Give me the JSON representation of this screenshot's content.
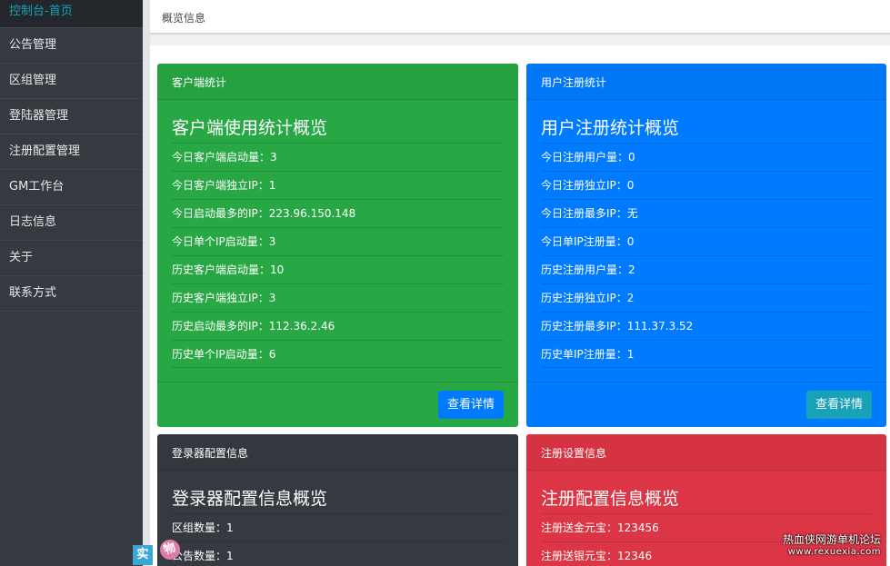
{
  "sidebar": {
    "items": [
      {
        "label": "控制台-首页"
      },
      {
        "label": "公告管理"
      },
      {
        "label": "区组管理"
      },
      {
        "label": "登陆器管理"
      },
      {
        "label": "注册配置管理"
      },
      {
        "label": "GM工作台"
      },
      {
        "label": "日志信息"
      },
      {
        "label": "关于"
      },
      {
        "label": "联系方式"
      }
    ],
    "active_color": "#17a2b8"
  },
  "header": {
    "title": "概览信息"
  },
  "cards": {
    "client": {
      "header": "客户端统计",
      "title": "客户端使用统计概览",
      "rows": [
        "今日客户端启动量：3",
        "今日客户端独立IP：1",
        "今日启动最多的IP：223.96.150.148",
        "今日单个IP启动量：3",
        "历史客户端启动量：10",
        "历史客户端独立IP：3",
        "历史启动最多的IP：112.36.2.46",
        "历史单个IP启动量：6"
      ],
      "button": "查看详情",
      "color": "#28a745"
    },
    "register": {
      "header": "用户注册统计",
      "title": "用户注册统计概览",
      "rows": [
        "今日注册用户量：0",
        "今日注册独立IP：0",
        "今日注册最多IP：无",
        "今日单IP注册量：0",
        "历史注册用户量：2",
        "历史注册独立IP：2",
        "历史注册最多IP：111.37.3.52",
        "历史单IP注册量：1"
      ],
      "button": "查看详情",
      "color": "#007bff"
    },
    "launcher": {
      "header": "登录器配置信息",
      "title": "登录器配置信息概览",
      "rows": [
        "区组数量：1",
        "公告数量：1"
      ],
      "color": "#343a40"
    },
    "regconf": {
      "header": "注册设置信息",
      "title": "注册配置信息概览",
      "rows": [
        "注册送金元宝：123456",
        "注册送银元宝：12346"
      ],
      "color": "#dc3545"
    }
  },
  "watermark": {
    "line1": "热血侠网游单机论坛",
    "line2": "www.rexuexia.com"
  },
  "stamps": [
    "实",
    "物"
  ]
}
